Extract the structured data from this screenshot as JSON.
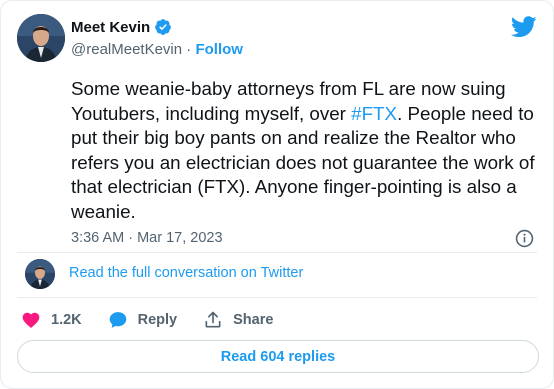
{
  "author": {
    "display_name": "Meet Kevin",
    "handle": "@realMeetKevin",
    "separator": " · ",
    "follow_label": "Follow"
  },
  "tweet": {
    "text_part1": "Some weanie-baby attorneys from FL are now suing Youtubers, including myself, over ",
    "hashtag": "#FTX",
    "text_part2": ". People need to put their big boy pants on and realize the Realtor who refers you an electrician does not guarantee the work of that electrician (FTX). Anyone finger-pointing is also a weanie.",
    "timestamp": "3:36 AM · Mar 17, 2023"
  },
  "conversation": {
    "link_label": "Read the full conversation on Twitter"
  },
  "actions": {
    "like_count": "1.2K",
    "reply_label": "Reply",
    "share_label": "Share"
  },
  "replies": {
    "button_label": "Read 604 replies"
  },
  "colors": {
    "accent": "#1d9bf0",
    "like": "#f91880",
    "text": "#0f1419",
    "muted": "#536471"
  },
  "icons": {
    "verified": "verified-badge-icon",
    "brand": "twitter-bird-icon",
    "info": "info-icon",
    "like": "heart-icon",
    "reply": "speech-bubble-icon",
    "share": "share-upload-icon"
  }
}
